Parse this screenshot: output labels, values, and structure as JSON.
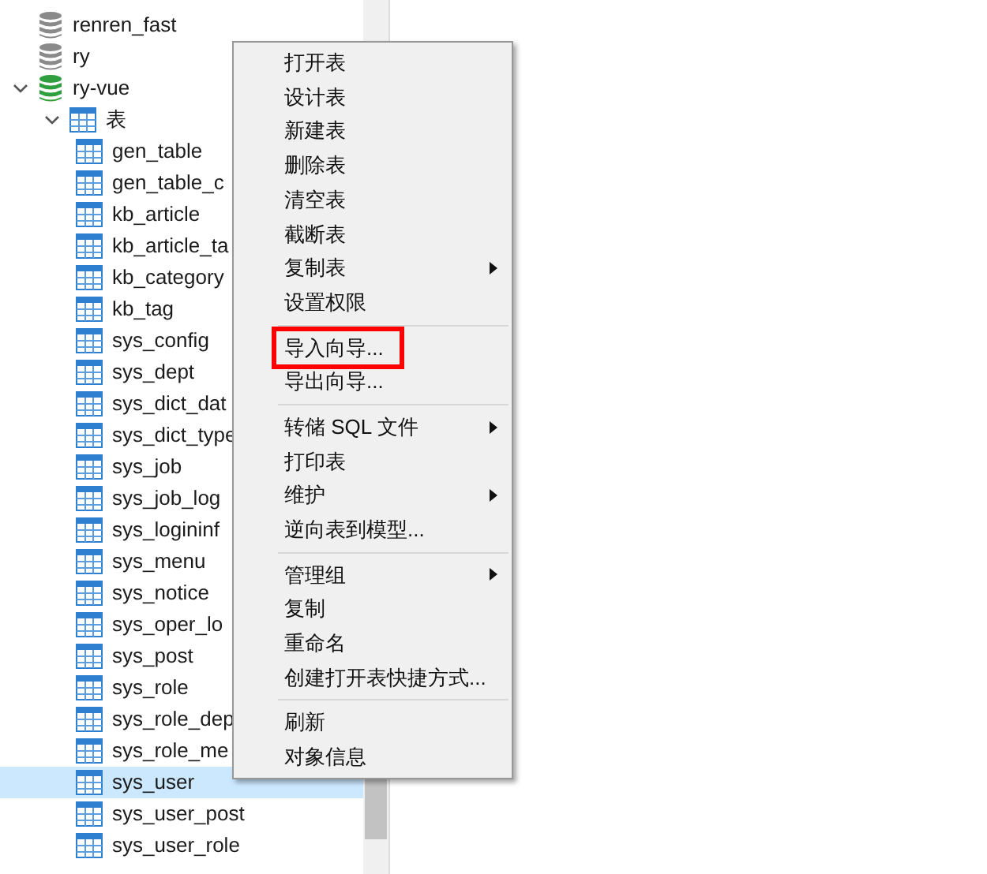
{
  "tree": [
    {
      "label": "renren_fast",
      "kind": "database",
      "connected": false,
      "expanded": false
    },
    {
      "label": "ry",
      "kind": "database",
      "connected": false,
      "expanded": false
    },
    {
      "label": "ry-vue",
      "kind": "database",
      "connected": true,
      "expanded": true,
      "children": [
        {
          "label": "表",
          "kind": "group",
          "expanded": true,
          "children": [
            {
              "label": "gen_table",
              "kind": "table",
              "selected": false
            },
            {
              "label": "gen_table_c",
              "kind": "table",
              "selected": false
            },
            {
              "label": "kb_article",
              "kind": "table",
              "selected": false
            },
            {
              "label": "kb_article_ta",
              "kind": "table",
              "selected": false
            },
            {
              "label": "kb_category",
              "kind": "table",
              "selected": false
            },
            {
              "label": "kb_tag",
              "kind": "table",
              "selected": false
            },
            {
              "label": "sys_config",
              "kind": "table",
              "selected": false
            },
            {
              "label": "sys_dept",
              "kind": "table",
              "selected": false
            },
            {
              "label": "sys_dict_dat",
              "kind": "table",
              "selected": false
            },
            {
              "label": "sys_dict_type",
              "kind": "table",
              "selected": false
            },
            {
              "label": "sys_job",
              "kind": "table",
              "selected": false
            },
            {
              "label": "sys_job_log",
              "kind": "table",
              "selected": false
            },
            {
              "label": "sys_logininf",
              "kind": "table",
              "selected": false
            },
            {
              "label": "sys_menu",
              "kind": "table",
              "selected": false
            },
            {
              "label": "sys_notice",
              "kind": "table",
              "selected": false
            },
            {
              "label": "sys_oper_lo",
              "kind": "table",
              "selected": false
            },
            {
              "label": "sys_post",
              "kind": "table",
              "selected": false
            },
            {
              "label": "sys_role",
              "kind": "table",
              "selected": false
            },
            {
              "label": "sys_role_dep",
              "kind": "table",
              "selected": false
            },
            {
              "label": "sys_role_me",
              "kind": "table",
              "selected": false
            },
            {
              "label": "sys_user",
              "kind": "table",
              "selected": true
            },
            {
              "label": "sys_user_post",
              "kind": "table",
              "selected": false
            },
            {
              "label": "sys_user_role",
              "kind": "table",
              "selected": false
            }
          ]
        }
      ]
    }
  ],
  "context_menu": [
    [
      {
        "label": "打开表",
        "submenu": false,
        "highlighted": false
      },
      {
        "label": "设计表",
        "submenu": false,
        "highlighted": false
      },
      {
        "label": "新建表",
        "submenu": false,
        "highlighted": false
      },
      {
        "label": "删除表",
        "submenu": false,
        "highlighted": false
      },
      {
        "label": "清空表",
        "submenu": false,
        "highlighted": false
      },
      {
        "label": "截断表",
        "submenu": false,
        "highlighted": false
      },
      {
        "label": "复制表",
        "submenu": true,
        "highlighted": false
      },
      {
        "label": "设置权限",
        "submenu": false,
        "highlighted": false
      }
    ],
    [
      {
        "label": "导入向导...",
        "submenu": false,
        "highlighted": true
      },
      {
        "label": "导出向导...",
        "submenu": false,
        "highlighted": false
      }
    ],
    [
      {
        "label": "转储 SQL 文件",
        "submenu": true,
        "highlighted": false
      },
      {
        "label": "打印表",
        "submenu": false,
        "highlighted": false
      },
      {
        "label": "维护",
        "submenu": true,
        "highlighted": false
      },
      {
        "label": "逆向表到模型...",
        "submenu": false,
        "highlighted": false
      }
    ],
    [
      {
        "label": "管理组",
        "submenu": true,
        "highlighted": false
      },
      {
        "label": "复制",
        "submenu": false,
        "highlighted": false
      },
      {
        "label": "重命名",
        "submenu": false,
        "highlighted": false
      },
      {
        "label": "创建打开表快捷方式...",
        "submenu": false,
        "highlighted": false
      }
    ],
    [
      {
        "label": "刷新",
        "submenu": false,
        "highlighted": false
      },
      {
        "label": "对象信息",
        "submenu": false,
        "highlighted": false
      }
    ]
  ]
}
